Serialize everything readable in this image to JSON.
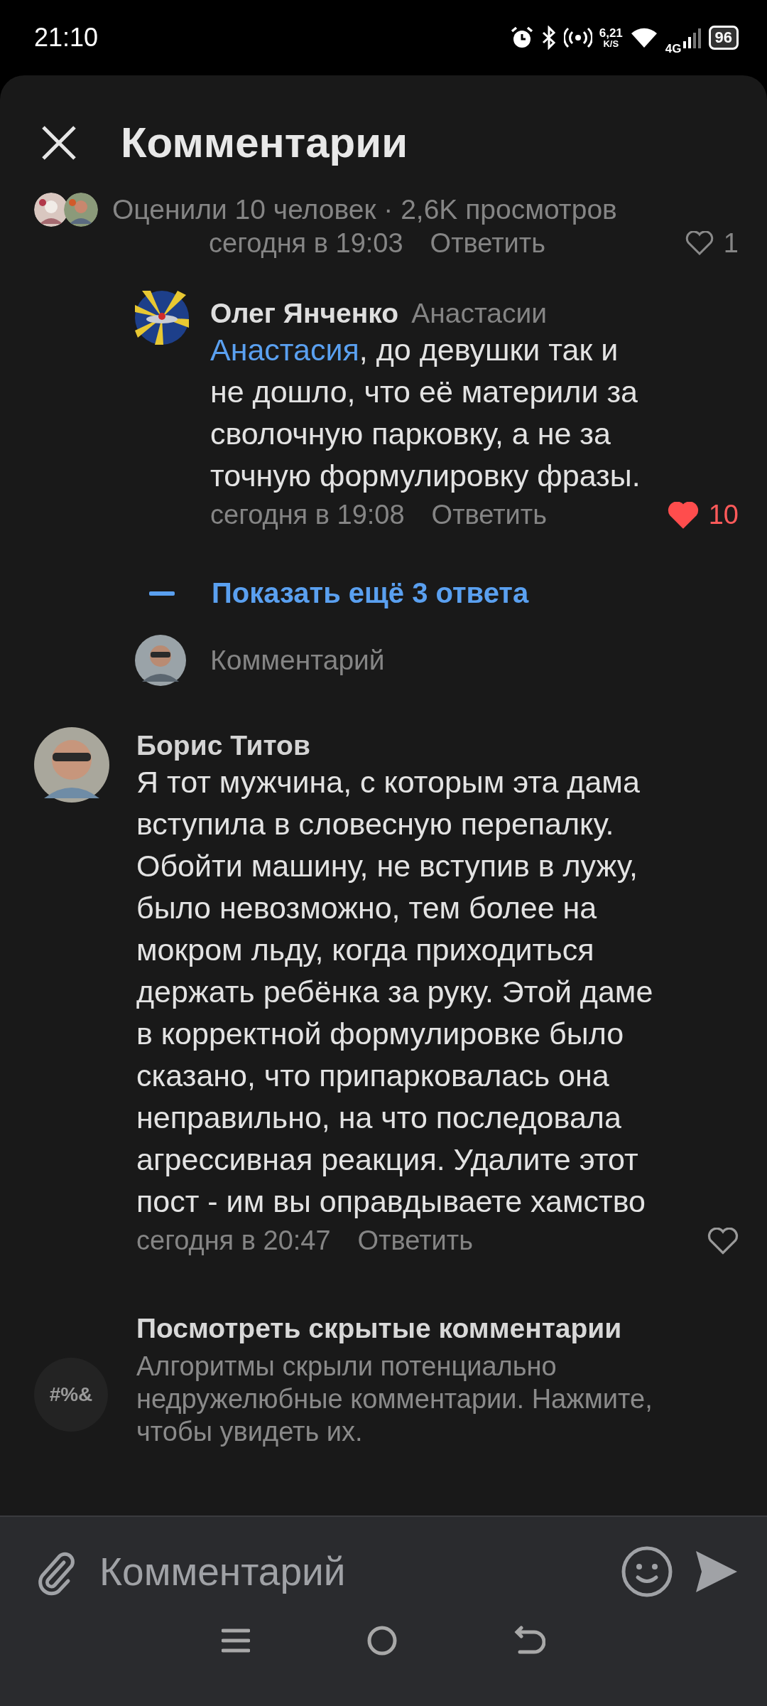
{
  "status_bar": {
    "time": "21:10",
    "speed_value": "6,21",
    "speed_unit": "K/S",
    "network": "4G",
    "battery": "96"
  },
  "header": {
    "title": "Комментарии"
  },
  "likes_summary": {
    "text": "Оценили 10 человек · 2,6K просмотров"
  },
  "cut_comment_meta": {
    "time": "сегодня в 19:03",
    "reply": "Ответить",
    "likes": "1",
    "liked": false
  },
  "reply": {
    "author": "Олег Янченко",
    "to": "Анастасии",
    "mention": "Анастасия",
    "text": ", до девушки так и\nне дошло, что её материли за\nсволочную парковку, а не за\nточную формулировку фразы.",
    "time": "сегодня в 19:08",
    "reply": "Ответить",
    "likes": "10",
    "liked": true
  },
  "show_more": {
    "label": "Показать ещё 3 ответа"
  },
  "reply_field": {
    "placeholder": "Комментарий"
  },
  "comment": {
    "author": "Борис Титов",
    "text": "Я тот мужчина, с которым эта дама\nвступила в словесную перепалку.\nОбойти машину, не вступив в лужу,\nбыло невозможно, тем более на\nмокром льду, когда приходиться\nдержать ребёнка за руку. Этой даме\nв корректной формулировке было\nсказано, что припарковалась она\nнеправильно, на что последовала\nагрессивная реакция. Удалите этот\nпост - им вы оправдываете хамство",
    "time": "сегодня в 20:47",
    "reply": "Ответить",
    "liked": false
  },
  "hidden_comments": {
    "icon_text": "#%&",
    "title": "Посмотреть скрытые комментарии",
    "description": "Алгоритмы скрыли потенциально\nнедружелюбные комментарии. Нажмите,\nчтобы увидеть их."
  },
  "composer": {
    "placeholder": "Комментарий"
  }
}
